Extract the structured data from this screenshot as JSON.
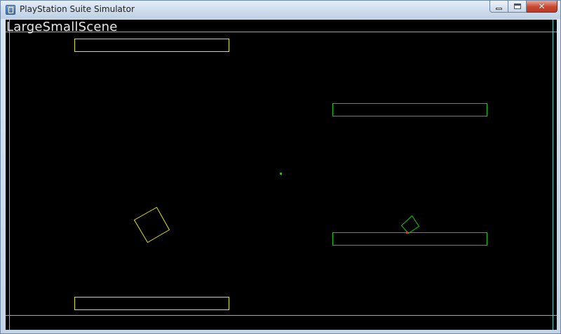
{
  "window": {
    "title": "PlayStation Suite Simulator",
    "app_icon": "app-icon",
    "buttons": {
      "minimize_icon": "minimize-icon",
      "maximize_icon": "maximize-icon",
      "close_icon": "close-icon",
      "close_glyph": "✕"
    }
  },
  "scene": {
    "name": "LargeSmallScene",
    "colors": {
      "background": "#000000",
      "safe_area": "#38d0d0",
      "yellow": "#e5e500",
      "green": "#00d000",
      "red": "#ff2020"
    }
  }
}
